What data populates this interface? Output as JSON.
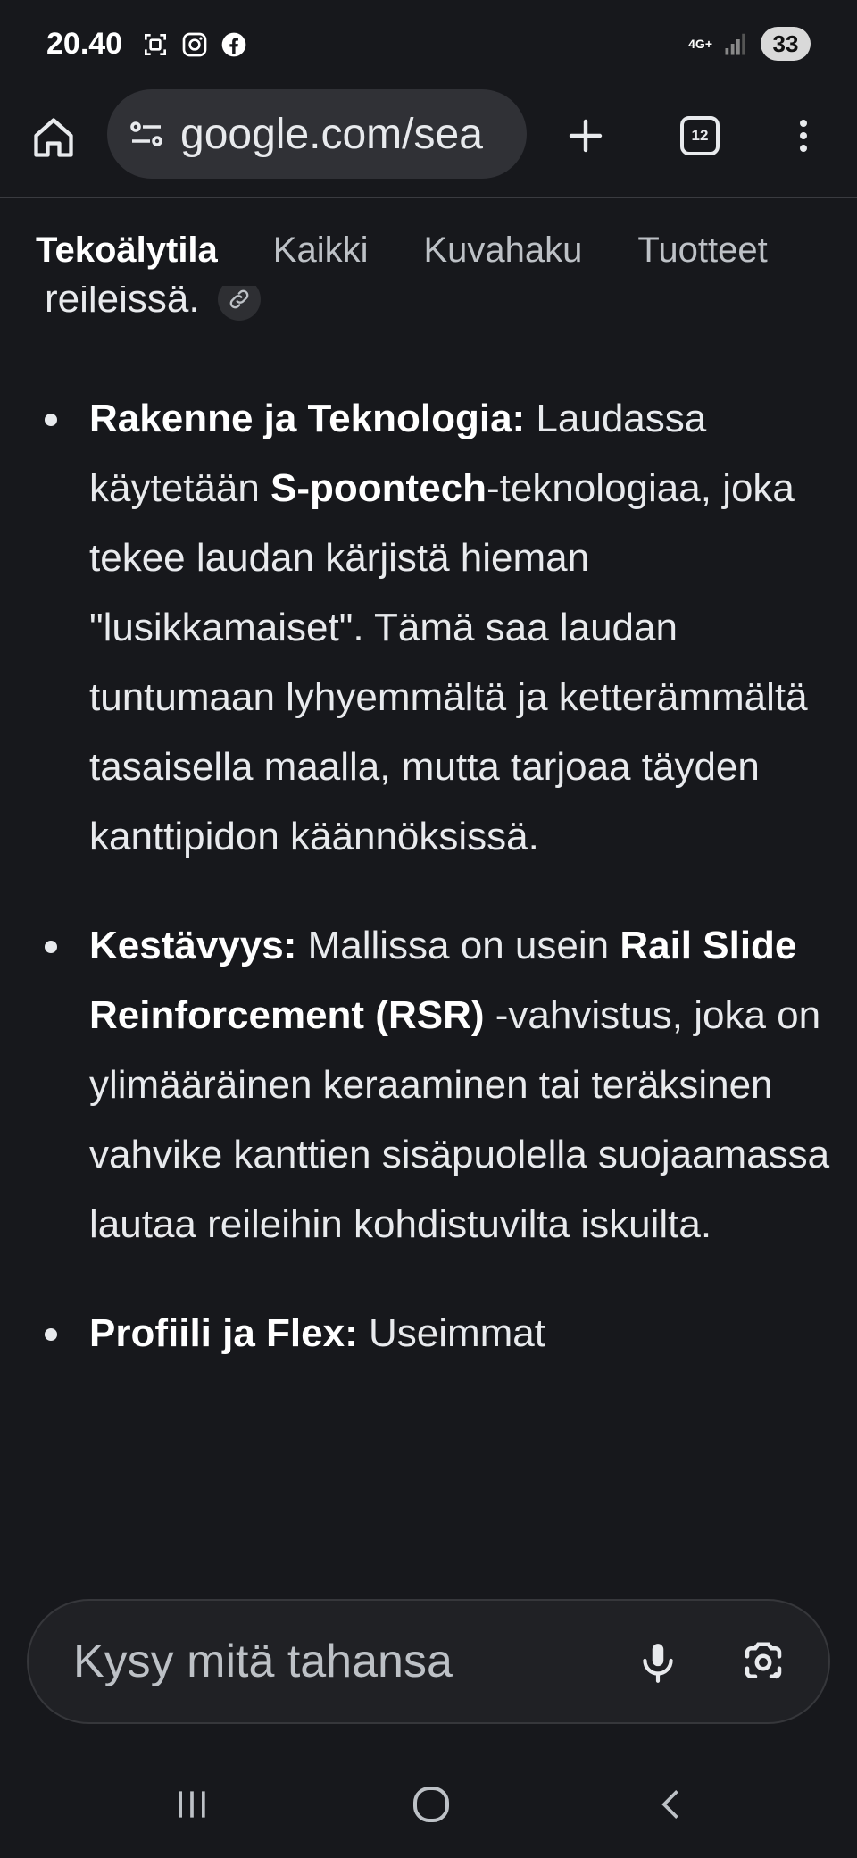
{
  "status_bar": {
    "time": "20.40",
    "left_icons": [
      "screenshot-icon",
      "instagram-icon",
      "facebook-icon"
    ],
    "network_label": "4G+",
    "battery": "33"
  },
  "toolbar": {
    "url": "google.com/sea",
    "tab_count": "12"
  },
  "search_tabs": [
    {
      "label": "Tekoälytila",
      "active": true
    },
    {
      "label": "Kaikki",
      "active": false
    },
    {
      "label": "Kuvahaku",
      "active": false
    },
    {
      "label": "Tuotteet",
      "active": false
    }
  ],
  "content": {
    "partial_top_text": "reileissä.",
    "bullets": [
      {
        "segments": [
          {
            "text": "Rakenne ja Teknologia:",
            "bold": true
          },
          {
            "text": " Laudassa käytetään ",
            "bold": false
          },
          {
            "text": "S-poontech",
            "bold": true
          },
          {
            "text": "-teknologiaa, joka tekee laudan kärjistä hieman \"lusikkamaiset\". Tämä saa laudan tuntumaan lyhyemmältä ja ketterämmältä tasaisella maalla, mutta tarjoaa täyden kanttipidon käännöksissä.",
            "bold": false
          }
        ]
      },
      {
        "segments": [
          {
            "text": "Kestävyys:",
            "bold": true
          },
          {
            "text": " Mallissa on usein ",
            "bold": false
          },
          {
            "text": "Rail Slide Reinforcement (RSR)",
            "bold": true
          },
          {
            "text": " -vahvistus, joka on ylimääräinen keraaminen tai teräksinen vahvike kanttien sisäpuolella suojaamassa lautaa reileihin kohdistuvilta iskuilta.",
            "bold": false
          }
        ]
      },
      {
        "segments": [
          {
            "text": "Profiili ja Flex:",
            "bold": true
          },
          {
            "text": " Useimmat",
            "bold": false
          }
        ]
      }
    ]
  },
  "ask_bar": {
    "placeholder": "Kysy mitä tahansa"
  },
  "colors": {
    "background": "#17181c",
    "text": "#e8eaed",
    "url_bar": "#303136",
    "ask_bar": "#202125"
  }
}
